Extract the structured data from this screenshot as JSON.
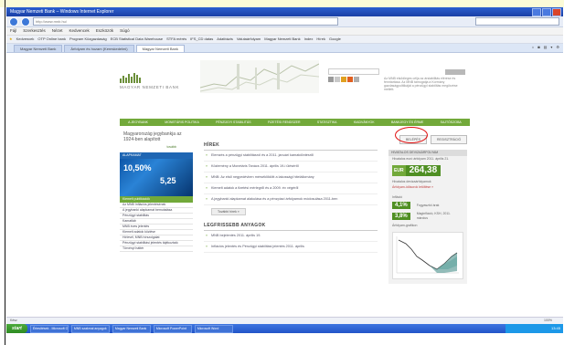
{
  "window": {
    "title": "Magyar Nemzeti Bank – Windows Internet Explorer",
    "url": "http://www.mnb.hu/"
  },
  "menu": [
    "Fájl",
    "Szerkesztés",
    "Nézet",
    "Kedvencek",
    "Eszközök",
    "Súgó"
  ],
  "favorites": [
    "Kedvencek",
    "OTP Online bank",
    "Program Közgazdaság",
    "ECB Statistical Data Warehouse",
    "STFA mérés",
    "IFS_CD datas",
    "Adatbázis",
    "Valutaárfolyam",
    "Magyar Nemzeti Bank",
    "Index",
    "Hírek",
    "Google"
  ],
  "tabs": [
    "Magyar Nemzeti Bank",
    "Árfolyam és hozam (Kereskedelmi)",
    "Magyar Nemzeti Bank"
  ],
  "site": {
    "logo_text": "MAGYAR NEMZETI BANK",
    "search_button": "KERESÉS",
    "header_text": "Az MNB elsődleges célja az árstabilitás elérése és fenntartása. Az MNB támogatja a Kormány gazdaságpolitikáját a pénzügyi stabilitás megőrzése mellett.",
    "nav": [
      "A JEGYBANK",
      "MONETÁRIS POLITIKA",
      "PÉNZÜGYI STABILITÁS",
      "FIZETÉSI RENDSZER",
      "STATISZTIKA",
      "KIADVÁNYOK",
      "BANKJEGY ÉS ÉRME",
      "SAJTÓSZOBA"
    ],
    "left_intro": "Magyarország jegybankja az 1924-ben alapított",
    "left_more": "tovább",
    "left_banner_head": "ALAPKAMAT",
    "left_banner_vals": [
      "10,50%",
      "5,25"
    ],
    "left_green": "Kiemelt publikációk",
    "left_links": [
      "Az MNB Inflációs jelentésének",
      "A jegybanki alapkamat bemutatása",
      "Pénzügyi stabilitás",
      "Kamatláb",
      "MNB éves jelentés",
      "Kiemelt adatok közlése",
      "Hírlevél, MNB hírszolgálat",
      "Pénzügyi stabilitási jelentés tájékoztató",
      "Törvényi háttér"
    ],
    "news_title": "HÍREK",
    "news": [
      "Elemzés a pénzügyi stabilitásról és a 2011. januári kamatdöntésről",
      "Közlemény a Monetáris Tanács 2011. április 19-i üléséről",
      "MNB: Az első negyedévben mérséklődött a lakossági hitelállomány",
      "Kiemelt adatok a fizetési mérlegről és a 2009. év végéről",
      "A jegybanki alapkamat alakulása és a pénzpiaci árfolyamok módosulása 2011-ben"
    ],
    "more_button": "További hírek »",
    "sub_title": "LEGFRISSEBB ANYAGOK",
    "sub_news": [
      "MNB bejelentés 2011. április 19.",
      "Inflációs jelentés és Pénzügyi stabilitási jelentés 2011. április"
    ],
    "pill_left": "BELÉPÉS",
    "pill_right": "REGISZTRÁCIÓ",
    "right_head": "HIVATALOS DEVIZAÁRFOLYAM",
    "right_text": "Hivatalos euró árfolyam 2011. április 21.",
    "eur_label": "EUR",
    "eur_value": "264,38",
    "right_link": "Hivatalos devizaárfolyamok",
    "right_link2": "Árfolyam-idősorok letöltése »",
    "infl_head": "Infláció",
    "infl_vals": [
      "4,1%",
      "3,8%"
    ],
    "infl_texts": [
      "Fogyasztói árak",
      "Maginfláció, KSH, 2011. március"
    ],
    "chart_head": "Árfolyam-grafikon"
  },
  "status": "Kész",
  "zoom": "100%",
  "taskbar": {
    "start": "start",
    "buttons": [
      "Értesítések - Microsoft Outlook",
      "MNB szakmai anyagok",
      "Magyar Nemzeti Bank",
      "Microsoft PowerPoint",
      "Microsoft Word"
    ],
    "clock": "13:45"
  }
}
